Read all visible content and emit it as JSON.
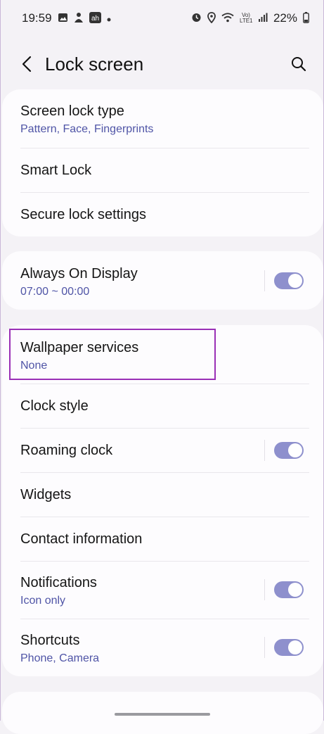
{
  "status_bar": {
    "time": "19:59",
    "battery": "22%",
    "icons_left": [
      "gallery-icon",
      "app-icon",
      "notification-icon",
      "dot-icon"
    ],
    "icons_right": [
      "alarm-icon",
      "location-icon",
      "wifi-icon",
      "volte-icon",
      "signal-icon",
      "battery-icon"
    ],
    "network_label": "Vo) LTE1"
  },
  "header": {
    "title": "Lock screen"
  },
  "sections": [
    {
      "items": [
        {
          "title": "Screen lock type",
          "subtitle": "Pattern, Face, Fingerprints"
        },
        {
          "title": "Smart Lock"
        },
        {
          "title": "Secure lock settings"
        }
      ]
    },
    {
      "items": [
        {
          "title": "Always On Display",
          "subtitle": "07:00 ~ 00:00",
          "toggle": true
        }
      ]
    },
    {
      "items": [
        {
          "title": "Wallpaper services",
          "subtitle": "None"
        },
        {
          "title": "Clock style"
        },
        {
          "title": "Roaming clock",
          "toggle": true
        },
        {
          "title": "Widgets"
        },
        {
          "title": "Contact information"
        },
        {
          "title": "Notifications",
          "subtitle": "Icon only",
          "toggle": true
        },
        {
          "title": "Shortcuts",
          "subtitle": "Phone, Camera",
          "toggle": true
        }
      ]
    }
  ],
  "colors": {
    "accent": "#8e90cd",
    "subtitle": "#4f54a6",
    "highlight": "#9a2fb6",
    "background": "#f4f2f6"
  }
}
